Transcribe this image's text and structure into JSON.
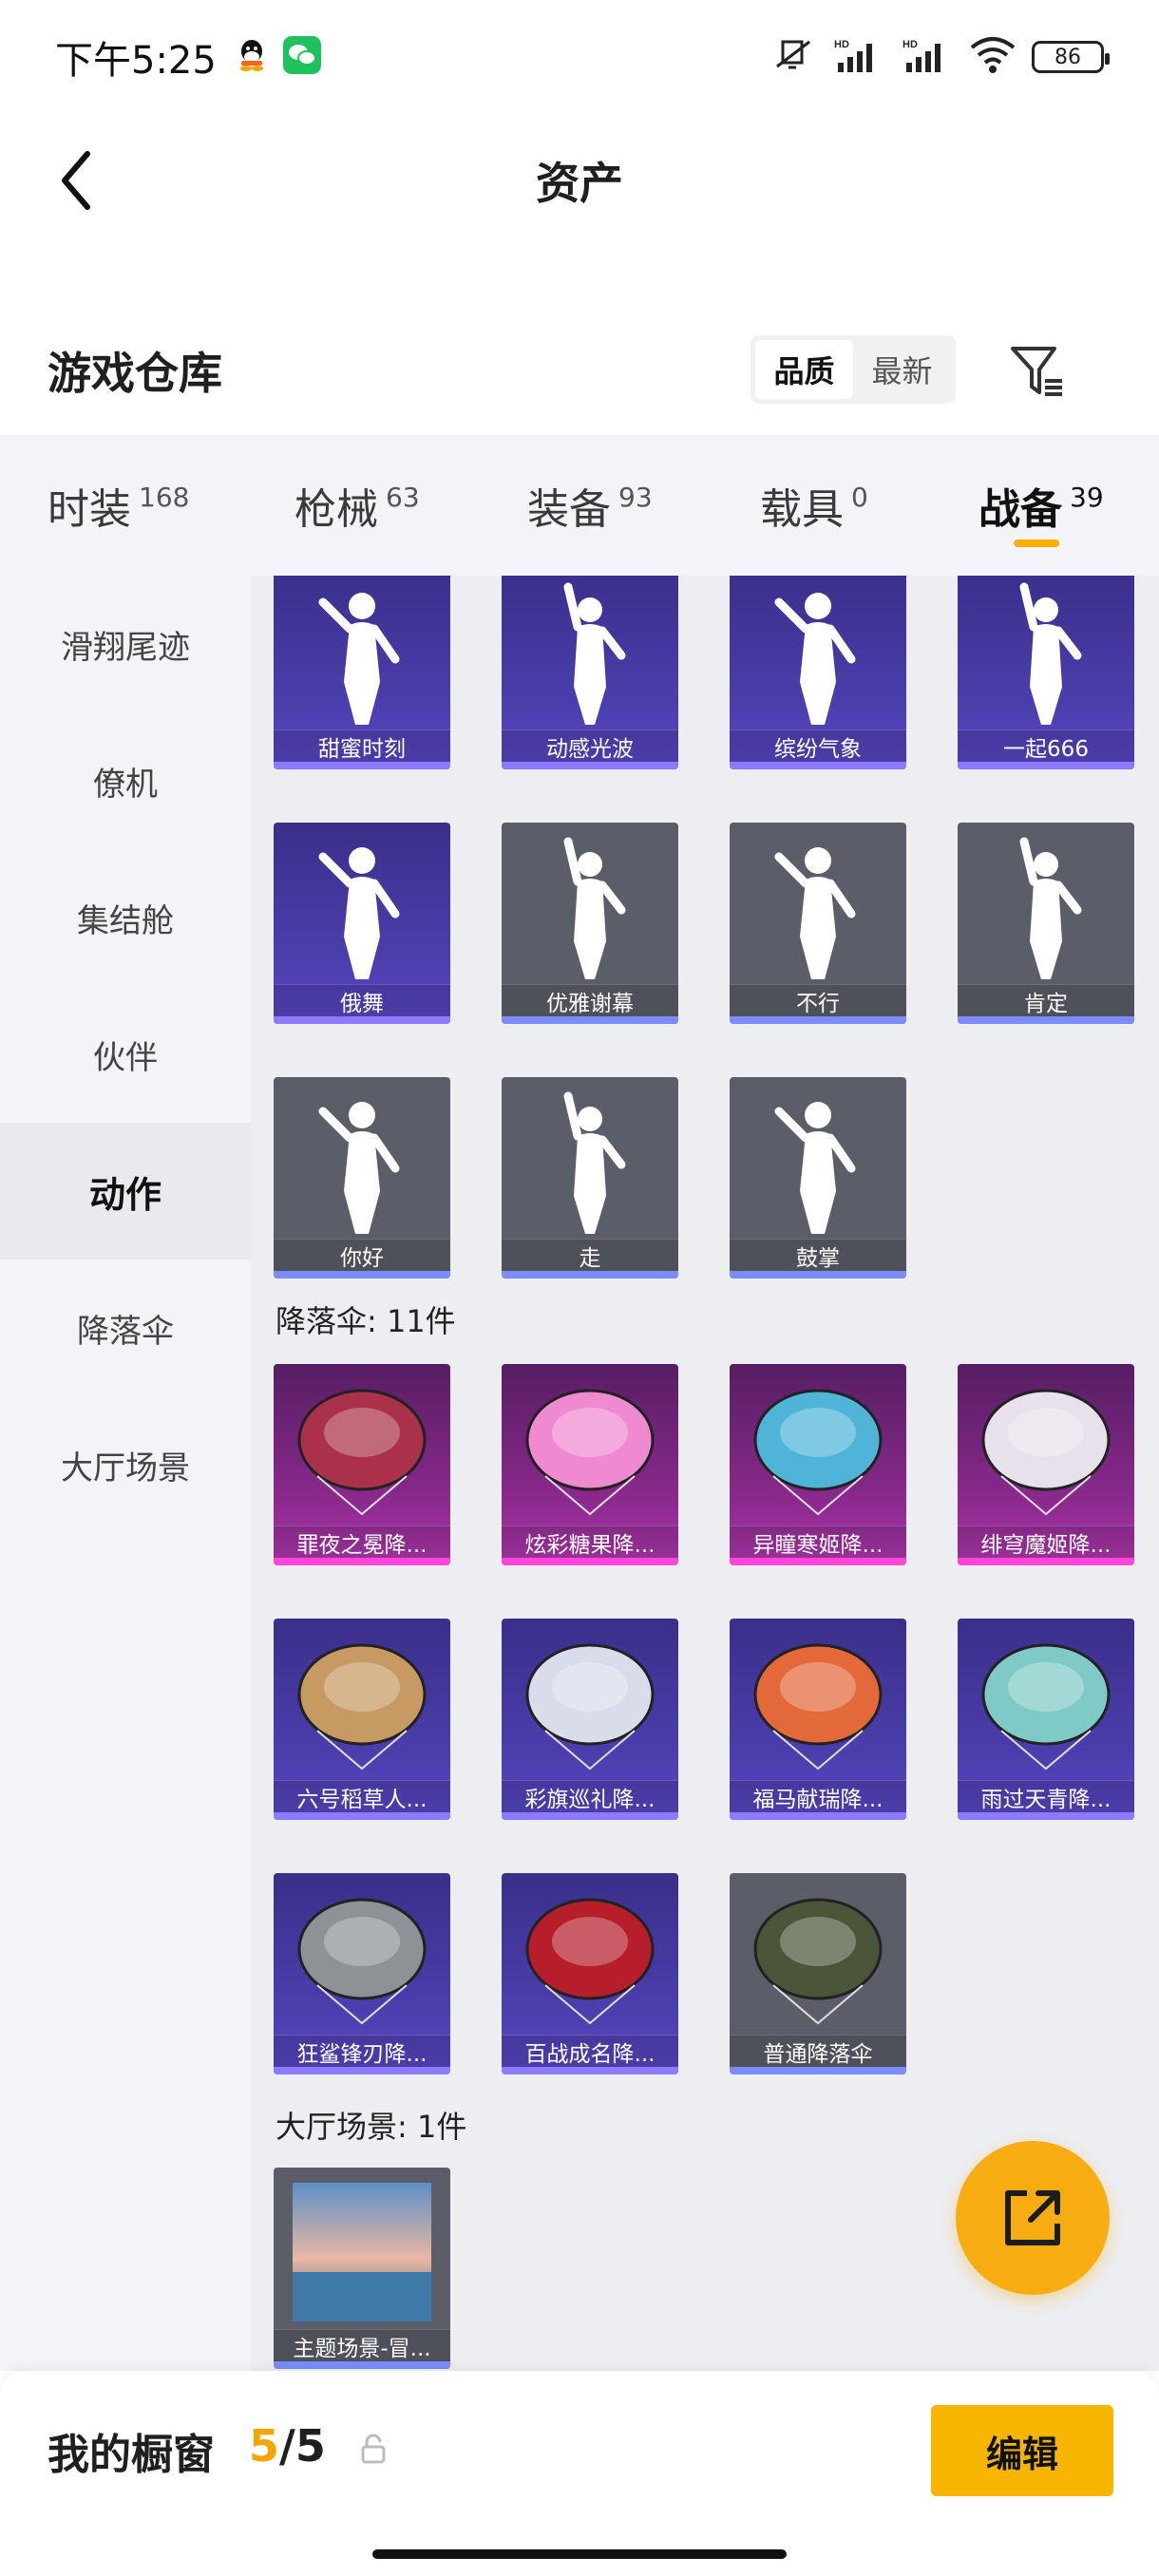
{
  "status_bar": {
    "time": "下午5:25",
    "battery": "86"
  },
  "nav": {
    "title": "资产"
  },
  "warehouse": {
    "title": "游戏仓库",
    "sort_quality": "品质",
    "sort_newest": "最新"
  },
  "tabs": [
    {
      "label": "时装",
      "count": "168"
    },
    {
      "label": "枪械",
      "count": "63"
    },
    {
      "label": "装备",
      "count": "93"
    },
    {
      "label": "载具",
      "count": "0"
    },
    {
      "label": "战备",
      "count": "39"
    }
  ],
  "sidebar": [
    "滑翔尾迹",
    "僚机",
    "集结舱",
    "伙伴",
    "动作",
    "降落伞",
    "大厅场景"
  ],
  "emotes": [
    {
      "name": "甜蜜时刻",
      "style": "purple"
    },
    {
      "name": "动感光波",
      "style": "purple"
    },
    {
      "name": "缤纷气象",
      "style": "purple"
    },
    {
      "name": "一起666",
      "style": "purple"
    },
    {
      "name": "俄舞",
      "style": "purple"
    },
    {
      "name": "优雅谢幕",
      "style": "grey"
    },
    {
      "name": "不行",
      "style": "grey"
    },
    {
      "name": "肯定",
      "style": "grey"
    },
    {
      "name": "你好",
      "style": "grey"
    },
    {
      "name": "走",
      "style": "grey"
    },
    {
      "name": "鼓掌",
      "style": "grey"
    }
  ],
  "parachute_section": "降落伞: 11件",
  "parachutes": [
    {
      "name": "罪夜之冕降...",
      "style": "magenta",
      "color": "#a9314a"
    },
    {
      "name": "炫彩糖果降...",
      "style": "magenta",
      "color": "#f08ad0"
    },
    {
      "name": "异瞳寒姬降...",
      "style": "magenta",
      "color": "#4fb4d8"
    },
    {
      "name": "绯穹魔姬降...",
      "style": "magenta",
      "color": "#e8e0ea"
    },
    {
      "name": "六号稻草人...",
      "style": "purple",
      "color": "#c79a63"
    },
    {
      "name": "彩旗巡礼降...",
      "style": "purple",
      "color": "#d9dcea"
    },
    {
      "name": "福马献瑞降...",
      "style": "purple",
      "color": "#e3693b"
    },
    {
      "name": "雨过天青降...",
      "style": "purple",
      "color": "#7fc9c7"
    },
    {
      "name": "狂鲨锋刃降...",
      "style": "purple",
      "color": "#8e9296"
    },
    {
      "name": "百战成名降...",
      "style": "purple",
      "color": "#b51e2a"
    },
    {
      "name": "普通降落伞",
      "style": "grey",
      "color": "#4b5539"
    }
  ],
  "lobby_section": "大厅场景: 1件",
  "lobby": [
    {
      "name": "主题场景-冒...",
      "style": "grey"
    }
  ],
  "showcase": {
    "title": "我的橱窗",
    "current": "5",
    "sep_total": "/5",
    "edit": "编辑"
  }
}
